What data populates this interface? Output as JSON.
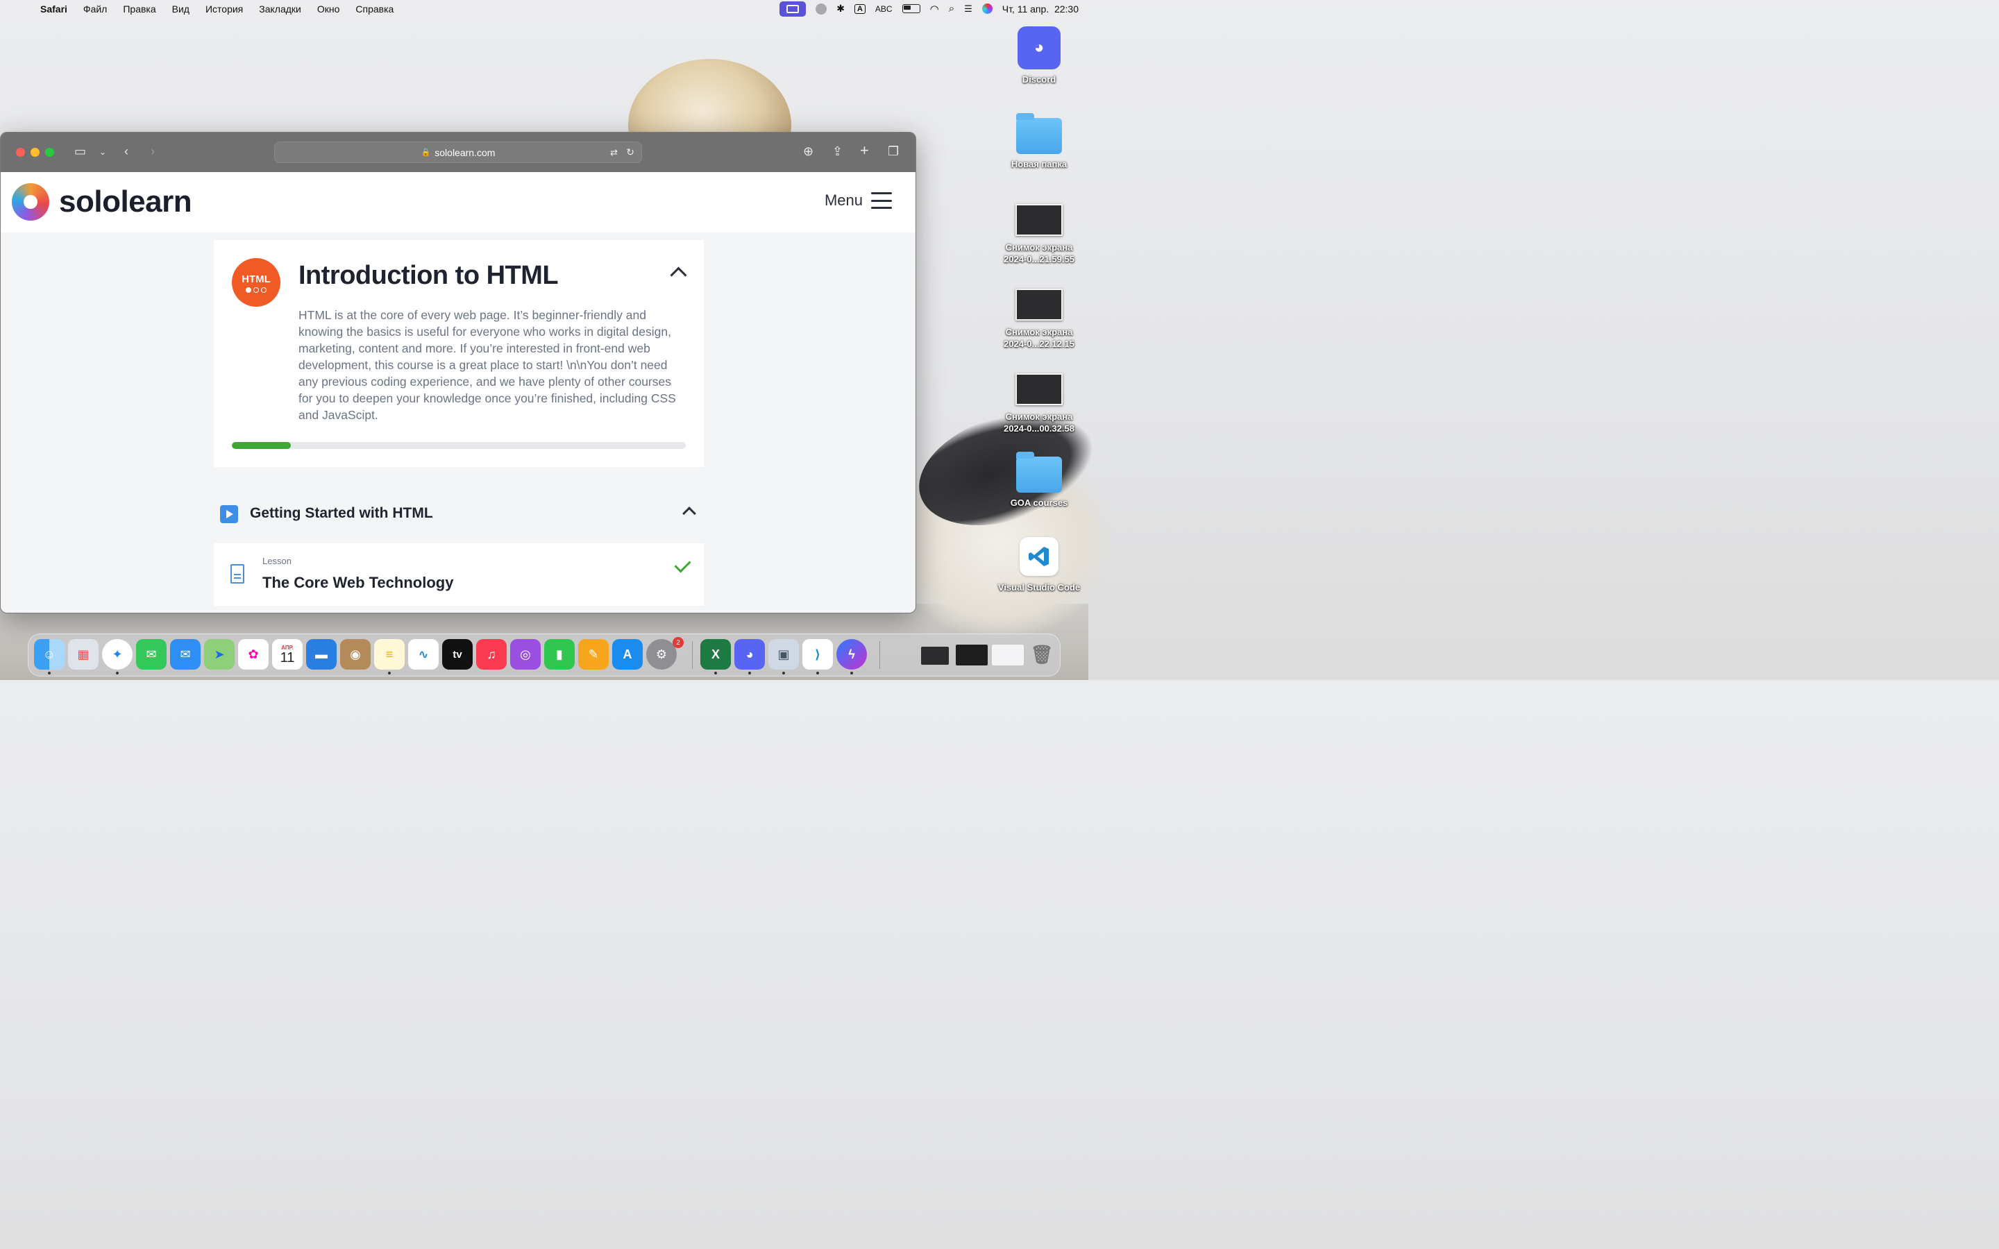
{
  "menubar": {
    "app": "Safari",
    "items": [
      "Файл",
      "Правка",
      "Вид",
      "История",
      "Закладки",
      "Окно",
      "Справка"
    ],
    "input_mode": "ABC",
    "datetime": "Чт, 11 апр.  22:30"
  },
  "desktop": {
    "icons": [
      "Discord",
      "Новая папка",
      "Снимок экрана 2024-0...21.59.55",
      "Снимок экрана 2024-0...22.12.15",
      "Снимок экрана 2024-0...00.32.58",
      "GOA courses",
      "Visual Studio Code"
    ]
  },
  "browser": {
    "url": "sololearn.com"
  },
  "site": {
    "brand": "sololearn",
    "menu_label": "Menu",
    "course": {
      "badge": "HTML",
      "title": "Introduction to HTML",
      "description": "HTML is at the core of every web page. It’s beginner-friendly and knowing the basics is useful for everyone who works in digital design, marketing, content and more. If you’re interested in front-end web development, this course is a great place to start! \\n\\nYou don’t need any previous coding experience, and we have plenty of other courses for you to deepen your knowledge once you’re finished, including CSS and JavaScipt.",
      "progress_fraction": 0.13
    },
    "section": {
      "title": "Getting Started with HTML"
    },
    "lesson": {
      "kind": "Lesson",
      "title": "The Core Web Technology"
    }
  },
  "dock": {
    "calendar_month": "АПР.",
    "calendar_day": "11",
    "tv_label": "tv",
    "settings_badge": "2",
    "apps": [
      "finder-icon",
      "launchpad-icon",
      "safari-icon",
      "messages-icon",
      "mail-icon",
      "maps-icon",
      "photos-icon",
      "calendar-icon",
      "keynote-icon",
      "contacts-icon",
      "notes-icon",
      "freeform-icon",
      "appletv-icon",
      "music-icon",
      "podcasts-icon",
      "numbers-icon",
      "pages-icon",
      "appstore-icon",
      "settings-icon",
      "excel-icon",
      "discord-icon",
      "preview-icon",
      "vscode-icon",
      "messenger-icon",
      "trash-icon"
    ]
  }
}
